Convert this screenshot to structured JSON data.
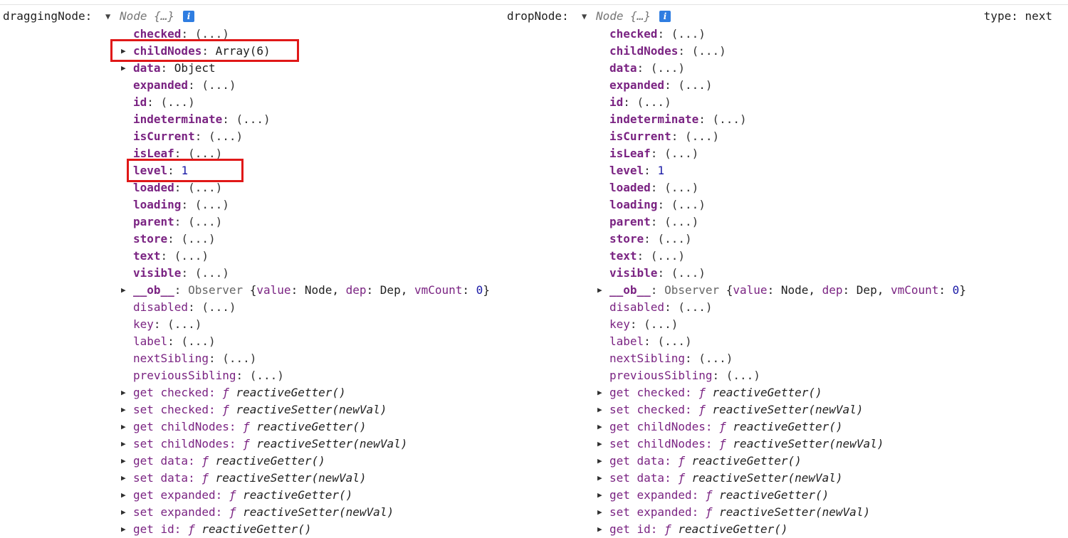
{
  "header": {
    "left_label": "draggingNode:",
    "left_node": "Node {…}",
    "right_label": "dropNode:",
    "right_node": "Node {…}",
    "info_glyph": "i",
    "type_label": "type: next"
  },
  "expand_glyph": "▶",
  "collapse_glyph": "▼",
  "lazy": "(...)",
  "dragging": {
    "checked": "checked",
    "childNodes": "childNodes",
    "childNodes_val": "Array(6)",
    "data": "data",
    "data_val": "Object",
    "expanded": "expanded",
    "id": "id",
    "indeterminate": "indeterminate",
    "isCurrent": "isCurrent",
    "isLeaf": "isLeaf",
    "level": "level",
    "level_val": "1",
    "loaded": "loaded",
    "loading": "loading",
    "parent": "parent",
    "store": "store",
    "text": "text",
    "visible": "visible",
    "ob": "__ob__",
    "ob_type": "Observer",
    "ob_value_key": "value",
    "ob_value": "Node",
    "ob_dep_key": "dep",
    "ob_dep": "Dep",
    "ob_vm_key": "vmCount",
    "ob_vm": "0",
    "disabled": "disabled",
    "key": "key",
    "label": "label",
    "nextSibling": "nextSibling",
    "previousSibling": "previousSibling"
  },
  "drop": {
    "checked": "checked",
    "childNodes": "childNodes",
    "data": "data",
    "expanded": "expanded",
    "id": "id",
    "indeterminate": "indeterminate",
    "isCurrent": "isCurrent",
    "isLeaf": "isLeaf",
    "level": "level",
    "level_val": "1",
    "loaded": "loaded",
    "loading": "loading",
    "parent": "parent",
    "store": "store",
    "text": "text",
    "visible": "visible",
    "ob": "__ob__",
    "ob_type": "Observer",
    "ob_value_key": "value",
    "ob_value": "Node",
    "ob_dep_key": "dep",
    "ob_dep": "Dep",
    "ob_vm_key": "vmCount",
    "ob_vm": "0",
    "disabled": "disabled",
    "key": "key",
    "label": "label",
    "nextSibling": "nextSibling",
    "previousSibling": "previousSibling"
  },
  "accessors": [
    {
      "prefix": "get checked:",
      "fn": "reactiveGetter()"
    },
    {
      "prefix": "set checked:",
      "fn": "reactiveSetter(newVal)"
    },
    {
      "prefix": "get childNodes:",
      "fn": "reactiveGetter()"
    },
    {
      "prefix": "set childNodes:",
      "fn": "reactiveSetter(newVal)"
    },
    {
      "prefix": "get data:",
      "fn": "reactiveGetter()"
    },
    {
      "prefix": "set data:",
      "fn": "reactiveSetter(newVal)"
    },
    {
      "prefix": "get expanded:",
      "fn": "reactiveGetter()"
    },
    {
      "prefix": "set expanded:",
      "fn": "reactiveSetter(newVal)"
    },
    {
      "prefix": "get id:",
      "fn": "reactiveGetter()"
    }
  ],
  "fsym": "ƒ",
  "colors": {
    "property_key": "#7a2382",
    "number": "#1a1aa6",
    "highlight": "#e01818",
    "info_icon": "#2f7de1"
  }
}
